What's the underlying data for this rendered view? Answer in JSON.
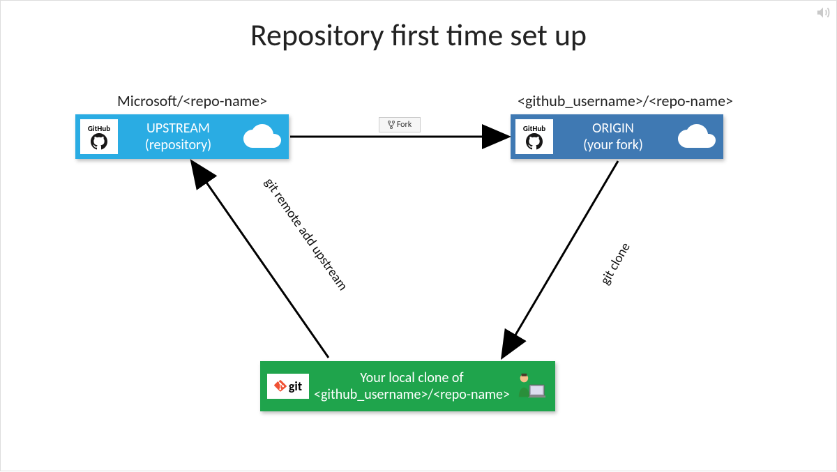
{
  "title": "Repository first time set up",
  "upstream": {
    "label": "Microsoft/<repo-name>",
    "line1": "UPSTREAM",
    "line2": "(repository)",
    "badge": "GitHub"
  },
  "origin": {
    "label": "<github_username>/<repo-name>",
    "line1": "ORIGIN",
    "line2": "(your fork)",
    "badge": "GitHub"
  },
  "local": {
    "line1": "Your local clone of",
    "line2": "<github_username>/<repo-name>",
    "badge": "git"
  },
  "fork_button": "Fork",
  "arrows": {
    "remote_add": "git remote add upstream",
    "clone": "git clone"
  },
  "colors": {
    "upstream_bg": "#2AACE3",
    "origin_bg": "#3F79B3",
    "local_bg": "#1FA44C"
  }
}
